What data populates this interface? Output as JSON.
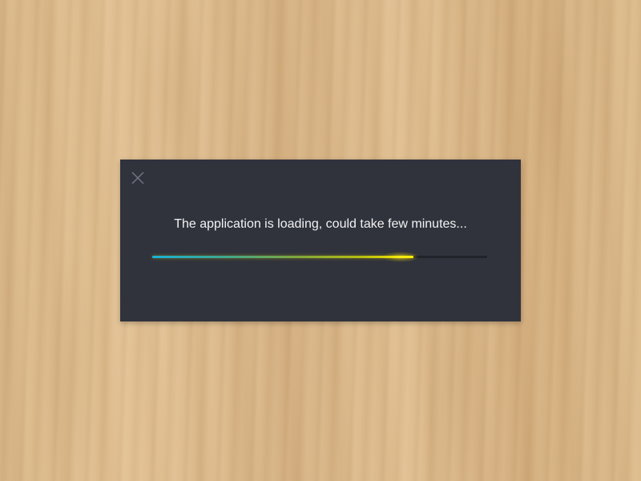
{
  "dialog": {
    "close_icon": "close-icon",
    "message": "The application is loading, could take few minutes...",
    "progress": 0.78,
    "colors": {
      "background": "#30333c",
      "track": "#20232a",
      "text": "#f2f2f2",
      "progress_start": "#19b3d8",
      "progress_end": "#ffef00",
      "close_icon": "#6f7580"
    }
  },
  "backdrop": {
    "texture": "light wood",
    "color": "#d9b98b"
  }
}
